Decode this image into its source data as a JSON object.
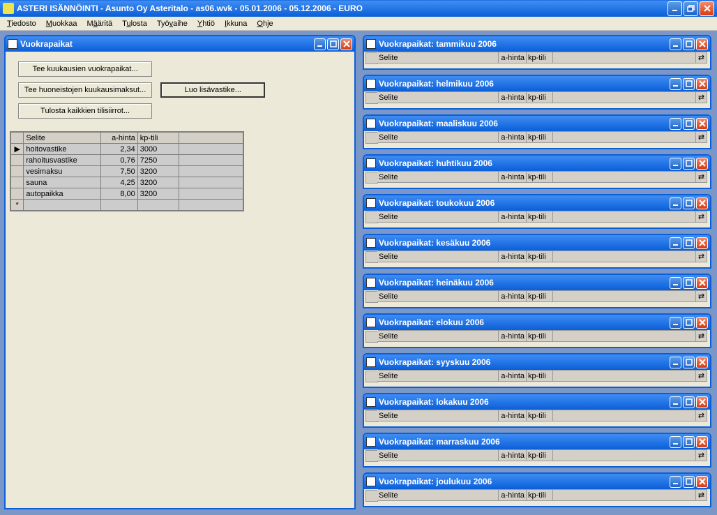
{
  "app": {
    "title": "ASTERI ISÄNNÖINTI - Asunto Oy Asteritalo - as06.wvk - 05.01.2006 - 05.12.2006 - EURO"
  },
  "menu": [
    "Tiedosto",
    "Muokkaa",
    "Määritä",
    "Tulosta",
    "Työvaihe",
    "Yhtiö",
    "Ikkuna",
    "Ohje"
  ],
  "main_window": {
    "title": "Vuokrapaikat",
    "buttons": {
      "b1": "Tee kuukausien vuokrapaikat...",
      "b2": "Tee huoneistojen kuukausimaksut...",
      "b3": "Tulosta kaikkien tilisiirrot...",
      "b4": "Luo lisävastike..."
    },
    "grid": {
      "headers": {
        "selite": "Selite",
        "ahinta": "a-hinta",
        "kptili": "kp-tili"
      },
      "rows": [
        {
          "selite": "hoitovastike",
          "ahinta": "2,34",
          "kptili": "3000"
        },
        {
          "selite": "rahoitusvastike",
          "ahinta": "0,76",
          "kptili": "7250"
        },
        {
          "selite": "vesimaksu",
          "ahinta": "7,50",
          "kptili": "3200"
        },
        {
          "selite": "sauna",
          "ahinta": "4,25",
          "kptili": "3200"
        },
        {
          "selite": "autopaikka",
          "ahinta": "8,00",
          "kptili": "3200"
        }
      ]
    }
  },
  "month_headers": {
    "selite": "Selite",
    "ahinta": "a-hinta",
    "kptili": "kp-tili"
  },
  "months": [
    {
      "title": "Vuokrapaikat: tammikuu 2006"
    },
    {
      "title": "Vuokrapaikat: helmikuu 2006"
    },
    {
      "title": "Vuokrapaikat: maaliskuu 2006"
    },
    {
      "title": "Vuokrapaikat: huhtikuu 2006"
    },
    {
      "title": "Vuokrapaikat: toukokuu 2006"
    },
    {
      "title": "Vuokrapaikat: kesäkuu 2006"
    },
    {
      "title": "Vuokrapaikat: heinäkuu 2006"
    },
    {
      "title": "Vuokrapaikat: elokuu 2006"
    },
    {
      "title": "Vuokrapaikat: syyskuu 2006"
    },
    {
      "title": "Vuokrapaikat: lokakuu 2006"
    },
    {
      "title": "Vuokrapaikat: marraskuu 2006"
    },
    {
      "title": "Vuokrapaikat: joulukuu 2006"
    }
  ]
}
